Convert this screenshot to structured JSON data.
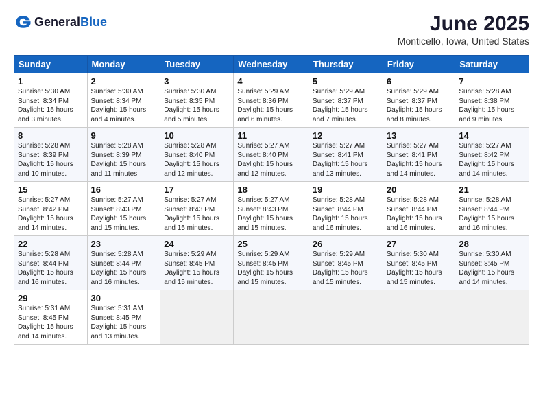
{
  "header": {
    "logo_general": "General",
    "logo_blue": "Blue",
    "title": "June 2025",
    "subtitle": "Monticello, Iowa, United States"
  },
  "days_of_week": [
    "Sunday",
    "Monday",
    "Tuesday",
    "Wednesday",
    "Thursday",
    "Friday",
    "Saturday"
  ],
  "weeks": [
    [
      {
        "day": "1",
        "sunrise": "5:30 AM",
        "sunset": "8:34 PM",
        "daylight": "15 hours and 3 minutes."
      },
      {
        "day": "2",
        "sunrise": "5:30 AM",
        "sunset": "8:34 PM",
        "daylight": "15 hours and 4 minutes."
      },
      {
        "day": "3",
        "sunrise": "5:30 AM",
        "sunset": "8:35 PM",
        "daylight": "15 hours and 5 minutes."
      },
      {
        "day": "4",
        "sunrise": "5:29 AM",
        "sunset": "8:36 PM",
        "daylight": "15 hours and 6 minutes."
      },
      {
        "day": "5",
        "sunrise": "5:29 AM",
        "sunset": "8:37 PM",
        "daylight": "15 hours and 7 minutes."
      },
      {
        "day": "6",
        "sunrise": "5:29 AM",
        "sunset": "8:37 PM",
        "daylight": "15 hours and 8 minutes."
      },
      {
        "day": "7",
        "sunrise": "5:28 AM",
        "sunset": "8:38 PM",
        "daylight": "15 hours and 9 minutes."
      }
    ],
    [
      {
        "day": "8",
        "sunrise": "5:28 AM",
        "sunset": "8:39 PM",
        "daylight": "15 hours and 10 minutes."
      },
      {
        "day": "9",
        "sunrise": "5:28 AM",
        "sunset": "8:39 PM",
        "daylight": "15 hours and 11 minutes."
      },
      {
        "day": "10",
        "sunrise": "5:28 AM",
        "sunset": "8:40 PM",
        "daylight": "15 hours and 12 minutes."
      },
      {
        "day": "11",
        "sunrise": "5:27 AM",
        "sunset": "8:40 PM",
        "daylight": "15 hours and 12 minutes."
      },
      {
        "day": "12",
        "sunrise": "5:27 AM",
        "sunset": "8:41 PM",
        "daylight": "15 hours and 13 minutes."
      },
      {
        "day": "13",
        "sunrise": "5:27 AM",
        "sunset": "8:41 PM",
        "daylight": "15 hours and 14 minutes."
      },
      {
        "day": "14",
        "sunrise": "5:27 AM",
        "sunset": "8:42 PM",
        "daylight": "15 hours and 14 minutes."
      }
    ],
    [
      {
        "day": "15",
        "sunrise": "5:27 AM",
        "sunset": "8:42 PM",
        "daylight": "15 hours and 14 minutes."
      },
      {
        "day": "16",
        "sunrise": "5:27 AM",
        "sunset": "8:43 PM",
        "daylight": "15 hours and 15 minutes."
      },
      {
        "day": "17",
        "sunrise": "5:27 AM",
        "sunset": "8:43 PM",
        "daylight": "15 hours and 15 minutes."
      },
      {
        "day": "18",
        "sunrise": "5:27 AM",
        "sunset": "8:43 PM",
        "daylight": "15 hours and 15 minutes."
      },
      {
        "day": "19",
        "sunrise": "5:28 AM",
        "sunset": "8:44 PM",
        "daylight": "15 hours and 16 minutes."
      },
      {
        "day": "20",
        "sunrise": "5:28 AM",
        "sunset": "8:44 PM",
        "daylight": "15 hours and 16 minutes."
      },
      {
        "day": "21",
        "sunrise": "5:28 AM",
        "sunset": "8:44 PM",
        "daylight": "15 hours and 16 minutes."
      }
    ],
    [
      {
        "day": "22",
        "sunrise": "5:28 AM",
        "sunset": "8:44 PM",
        "daylight": "15 hours and 16 minutes."
      },
      {
        "day": "23",
        "sunrise": "5:28 AM",
        "sunset": "8:44 PM",
        "daylight": "15 hours and 16 minutes."
      },
      {
        "day": "24",
        "sunrise": "5:29 AM",
        "sunset": "8:45 PM",
        "daylight": "15 hours and 15 minutes."
      },
      {
        "day": "25",
        "sunrise": "5:29 AM",
        "sunset": "8:45 PM",
        "daylight": "15 hours and 15 minutes."
      },
      {
        "day": "26",
        "sunrise": "5:29 AM",
        "sunset": "8:45 PM",
        "daylight": "15 hours and 15 minutes."
      },
      {
        "day": "27",
        "sunrise": "5:30 AM",
        "sunset": "8:45 PM",
        "daylight": "15 hours and 15 minutes."
      },
      {
        "day": "28",
        "sunrise": "5:30 AM",
        "sunset": "8:45 PM",
        "daylight": "15 hours and 14 minutes."
      }
    ],
    [
      {
        "day": "29",
        "sunrise": "5:31 AM",
        "sunset": "8:45 PM",
        "daylight": "15 hours and 14 minutes."
      },
      {
        "day": "30",
        "sunrise": "5:31 AM",
        "sunset": "8:45 PM",
        "daylight": "15 hours and 13 minutes."
      },
      null,
      null,
      null,
      null,
      null
    ]
  ]
}
